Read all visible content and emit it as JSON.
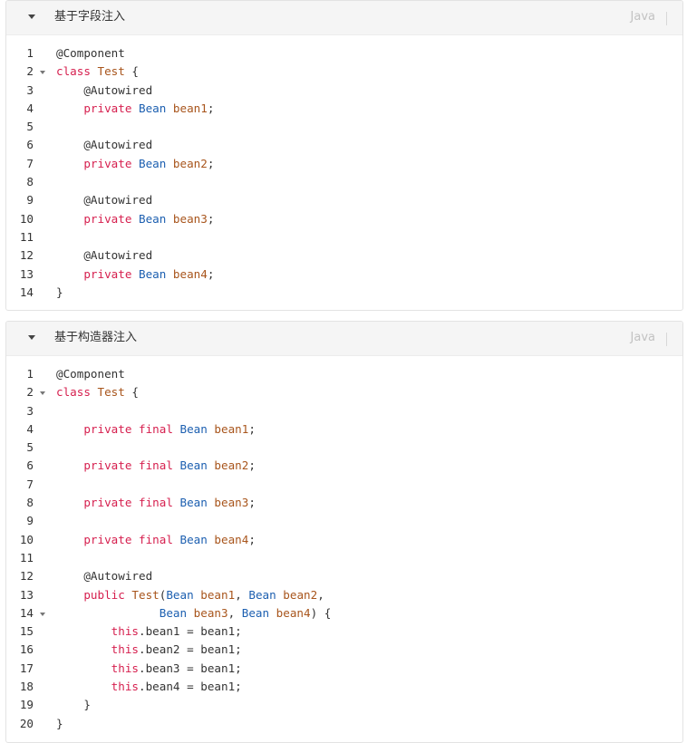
{
  "blocks": [
    {
      "title": "基于字段注入",
      "language": "Java",
      "lines": [
        {
          "num": "1",
          "fold": false,
          "tokens": [
            {
              "t": "@Component",
              "c": "plain"
            }
          ]
        },
        {
          "num": "2",
          "fold": true,
          "tokens": [
            {
              "t": "class ",
              "c": "kw"
            },
            {
              "t": "Test",
              "c": "var"
            },
            {
              "t": " {",
              "c": "plain"
            }
          ]
        },
        {
          "num": "3",
          "fold": false,
          "tokens": [
            {
              "t": "    @Autowired",
              "c": "plain"
            }
          ]
        },
        {
          "num": "4",
          "fold": false,
          "tokens": [
            {
              "t": "    private ",
              "c": "kw"
            },
            {
              "t": "Bean",
              "c": "type"
            },
            {
              "t": " bean1",
              "c": "var"
            },
            {
              "t": ";",
              "c": "plain"
            }
          ]
        },
        {
          "num": "5",
          "fold": false,
          "tokens": []
        },
        {
          "num": "6",
          "fold": false,
          "tokens": [
            {
              "t": "    @Autowired",
              "c": "plain"
            }
          ]
        },
        {
          "num": "7",
          "fold": false,
          "tokens": [
            {
              "t": "    private ",
              "c": "kw"
            },
            {
              "t": "Bean",
              "c": "type"
            },
            {
              "t": " bean2",
              "c": "var"
            },
            {
              "t": ";",
              "c": "plain"
            }
          ]
        },
        {
          "num": "8",
          "fold": false,
          "tokens": []
        },
        {
          "num": "9",
          "fold": false,
          "tokens": [
            {
              "t": "    @Autowired",
              "c": "plain"
            }
          ]
        },
        {
          "num": "10",
          "fold": false,
          "tokens": [
            {
              "t": "    private ",
              "c": "kw"
            },
            {
              "t": "Bean",
              "c": "type"
            },
            {
              "t": " bean3",
              "c": "var"
            },
            {
              "t": ";",
              "c": "plain"
            }
          ]
        },
        {
          "num": "11",
          "fold": false,
          "tokens": []
        },
        {
          "num": "12",
          "fold": false,
          "tokens": [
            {
              "t": "    @Autowired",
              "c": "plain"
            }
          ]
        },
        {
          "num": "13",
          "fold": false,
          "tokens": [
            {
              "t": "    private ",
              "c": "kw"
            },
            {
              "t": "Bean",
              "c": "type"
            },
            {
              "t": " bean4",
              "c": "var"
            },
            {
              "t": ";",
              "c": "plain"
            }
          ]
        },
        {
          "num": "14",
          "fold": false,
          "tokens": [
            {
              "t": "}",
              "c": "plain"
            }
          ]
        }
      ]
    },
    {
      "title": "基于构造器注入",
      "language": "Java",
      "lines": [
        {
          "num": "1",
          "fold": false,
          "tokens": [
            {
              "t": "@Component",
              "c": "plain"
            }
          ]
        },
        {
          "num": "2",
          "fold": true,
          "tokens": [
            {
              "t": "class ",
              "c": "kw"
            },
            {
              "t": "Test",
              "c": "var"
            },
            {
              "t": " {",
              "c": "plain"
            }
          ]
        },
        {
          "num": "3",
          "fold": false,
          "tokens": []
        },
        {
          "num": "4",
          "fold": false,
          "tokens": [
            {
              "t": "    private final ",
              "c": "kw"
            },
            {
              "t": "Bean",
              "c": "type"
            },
            {
              "t": " bean1",
              "c": "var"
            },
            {
              "t": ";",
              "c": "plain"
            }
          ]
        },
        {
          "num": "5",
          "fold": false,
          "tokens": []
        },
        {
          "num": "6",
          "fold": false,
          "tokens": [
            {
              "t": "    private final ",
              "c": "kw"
            },
            {
              "t": "Bean",
              "c": "type"
            },
            {
              "t": " bean2",
              "c": "var"
            },
            {
              "t": ";",
              "c": "plain"
            }
          ]
        },
        {
          "num": "7",
          "fold": false,
          "tokens": []
        },
        {
          "num": "8",
          "fold": false,
          "tokens": [
            {
              "t": "    private final ",
              "c": "kw"
            },
            {
              "t": "Bean",
              "c": "type"
            },
            {
              "t": " bean3",
              "c": "var"
            },
            {
              "t": ";",
              "c": "plain"
            }
          ]
        },
        {
          "num": "9",
          "fold": false,
          "tokens": []
        },
        {
          "num": "10",
          "fold": false,
          "tokens": [
            {
              "t": "    private final ",
              "c": "kw"
            },
            {
              "t": "Bean",
              "c": "type"
            },
            {
              "t": " bean4",
              "c": "var"
            },
            {
              "t": ";",
              "c": "plain"
            }
          ]
        },
        {
          "num": "11",
          "fold": false,
          "tokens": []
        },
        {
          "num": "12",
          "fold": false,
          "tokens": [
            {
              "t": "    @Autowired",
              "c": "plain"
            }
          ]
        },
        {
          "num": "13",
          "fold": false,
          "tokens": [
            {
              "t": "    public ",
              "c": "kw"
            },
            {
              "t": "Test",
              "c": "var"
            },
            {
              "t": "(",
              "c": "plain"
            },
            {
              "t": "Bean",
              "c": "type"
            },
            {
              "t": " bean1",
              "c": "var"
            },
            {
              "t": ", ",
              "c": "plain"
            },
            {
              "t": "Bean",
              "c": "type"
            },
            {
              "t": " bean2",
              "c": "var"
            },
            {
              "t": ",",
              "c": "plain"
            }
          ]
        },
        {
          "num": "14",
          "fold": true,
          "tokens": [
            {
              "t": "               ",
              "c": "plain"
            },
            {
              "t": "Bean",
              "c": "type"
            },
            {
              "t": " bean3",
              "c": "var"
            },
            {
              "t": ", ",
              "c": "plain"
            },
            {
              "t": "Bean",
              "c": "type"
            },
            {
              "t": " bean4",
              "c": "var"
            },
            {
              "t": ") {",
              "c": "plain"
            }
          ]
        },
        {
          "num": "15",
          "fold": false,
          "tokens": [
            {
              "t": "        this",
              "c": "kw"
            },
            {
              "t": ".bean1 = bean1;",
              "c": "plain"
            }
          ]
        },
        {
          "num": "16",
          "fold": false,
          "tokens": [
            {
              "t": "        this",
              "c": "kw"
            },
            {
              "t": ".bean2 = bean1;",
              "c": "plain"
            }
          ]
        },
        {
          "num": "17",
          "fold": false,
          "tokens": [
            {
              "t": "        this",
              "c": "kw"
            },
            {
              "t": ".bean3 = bean1;",
              "c": "plain"
            }
          ]
        },
        {
          "num": "18",
          "fold": false,
          "tokens": [
            {
              "t": "        this",
              "c": "kw"
            },
            {
              "t": ".bean4 = bean1;",
              "c": "plain"
            }
          ]
        },
        {
          "num": "19",
          "fold": false,
          "tokens": [
            {
              "t": "    }",
              "c": "plain"
            }
          ]
        },
        {
          "num": "20",
          "fold": false,
          "tokens": [
            {
              "t": "}",
              "c": "plain"
            }
          ]
        }
      ]
    }
  ]
}
